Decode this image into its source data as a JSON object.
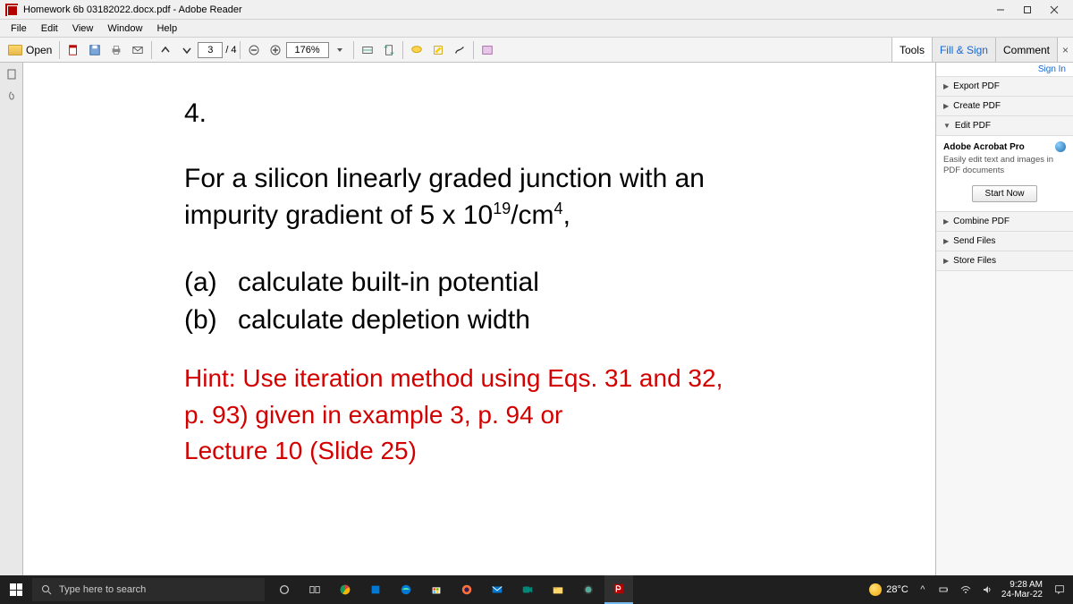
{
  "window": {
    "title": "Homework 6b 03182022.docx.pdf - Adobe Reader"
  },
  "menu": {
    "items": [
      "File",
      "Edit",
      "View",
      "Window",
      "Help"
    ]
  },
  "toolbar": {
    "open_label": "Open",
    "page_current": "3",
    "page_sep": "/",
    "page_total": "4",
    "zoom": "176%",
    "tabs": {
      "tools": "Tools",
      "fill_sign": "Fill & Sign",
      "comment": "Comment"
    }
  },
  "side": {
    "signin": "Sign In",
    "export_pdf": "Export PDF",
    "create_pdf": "Create PDF",
    "edit_pdf": "Edit PDF",
    "pro_title": "Adobe Acrobat Pro",
    "pro_desc": "Easily edit text and images in PDF documents",
    "start_now": "Start Now",
    "combine_pdf": "Combine PDF",
    "send_files": "Send Files",
    "store_files": "Store Files"
  },
  "document": {
    "q_num": "4.",
    "para1_a": "For a silicon linearly graded junction with an",
    "para1_b": "impurity gradient of 5 x 10",
    "para1_sup": "19",
    "para1_c": "/cm",
    "para1_sup2": "4",
    "para1_d": ",",
    "item_a_label": "(a)",
    "item_a_text": "calculate built-in potential",
    "item_b_label": "(b)",
    "item_b_text": "calculate depletion width",
    "hint1": "Hint: Use iteration method using Eqs. 31 and 32,",
    "hint2": "p. 93) given in example 3, p. 94 or",
    "hint3": "Lecture 10 (Slide 25)"
  },
  "taskbar": {
    "search_placeholder": "Type here to search",
    "temp": "28°C",
    "time": "9:28 AM",
    "date": "24-Mar-22"
  }
}
